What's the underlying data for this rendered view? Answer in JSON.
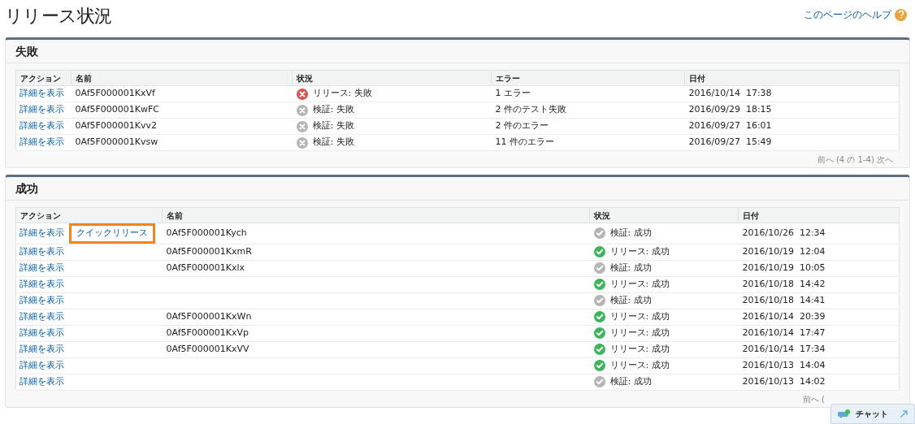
{
  "page_title": "リリース状況",
  "help_link": "このページのヘルプ",
  "sections": [
    {
      "title": "失敗",
      "columns": [
        "アクション",
        "名前",
        "状況",
        "エラー",
        "日付"
      ],
      "rows": [
        {
          "action": "詳細を表示",
          "name": "0Af5F000001KxVf",
          "kind": "error",
          "status": "リリース: 失敗",
          "error": "1 エラー",
          "date": "2016/10/14  17:38"
        },
        {
          "action": "詳細を表示",
          "name": "0Af5F000001KwFC",
          "kind": "cancel",
          "status": "検証: 失敗",
          "error": "2 件のテスト失敗",
          "date": "2016/09/29  18:15"
        },
        {
          "action": "詳細を表示",
          "name": "0Af5F000001Kvv2",
          "kind": "cancel",
          "status": "検証: 失敗",
          "error": "2 件のエラー",
          "date": "2016/09/27  16:01"
        },
        {
          "action": "詳細を表示",
          "name": "0Af5F000001Kvsw",
          "kind": "cancel",
          "status": "検証: 失敗",
          "error": "11 件のエラー",
          "date": "2016/09/27  15:49"
        }
      ],
      "pagination": "前へ (4 の 1-4) 次へ"
    },
    {
      "title": "成功",
      "columns": [
        "アクション",
        "名前",
        "状況",
        "日付"
      ],
      "rows": [
        {
          "action": "詳細を表示",
          "quick_release": {
            "label": "クイックリリース",
            "highlighted": true
          },
          "name": "0Af5F000001Kych",
          "kind": "neutral",
          "status": "検証: 成功",
          "date": "2016/10/26  12:34"
        },
        {
          "action": "詳細を表示",
          "name": "0Af5F000001KxmR",
          "kind": "success",
          "status": "リリース: 成功",
          "date": "2016/10/19  12:04"
        },
        {
          "action": "詳細を表示",
          "name": "0Af5F000001Kxlx",
          "kind": "neutral",
          "status": "検証: 成功",
          "date": "2016/10/19  10:05"
        },
        {
          "action": "詳細を表示",
          "kind": "success",
          "status": "リリース: 成功",
          "date": "2016/10/18  14:42"
        },
        {
          "action": "詳細を表示",
          "kind": "neutral",
          "status": "検証: 成功",
          "date": "2016/10/18  14:41"
        },
        {
          "action": "詳細を表示",
          "name": "0Af5F000001KxWn",
          "kind": "success",
          "status": "リリース: 成功",
          "date": "2016/10/14  20:39"
        },
        {
          "action": "詳細を表示",
          "name": "0Af5F000001KxVp",
          "kind": "success",
          "status": "リリース: 成功",
          "date": "2016/10/14  17:47"
        },
        {
          "action": "詳細を表示",
          "name": "0Af5F000001KxVV",
          "kind": "success",
          "status": "リリース: 成功",
          "date": "2016/10/14  17:34"
        },
        {
          "action": "詳細を表示",
          "kind": "success",
          "status": "リリース: 成功",
          "date": "2016/10/13  14:04"
        },
        {
          "action": "詳細を表示",
          "kind": "neutral",
          "status": "検証: 成功",
          "date": "2016/10/13  14:02"
        }
      ],
      "pagination": "前へ ("
    }
  ],
  "chat": {
    "label": "チャット"
  }
}
